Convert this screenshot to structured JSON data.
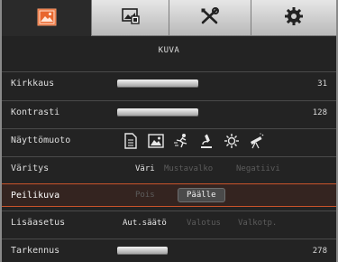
{
  "tabs": [
    {
      "icon": "picture-icon",
      "active": true
    },
    {
      "icon": "display-settings-icon",
      "active": false
    },
    {
      "icon": "tools-icon",
      "active": false
    },
    {
      "icon": "gear-icon",
      "active": false
    }
  ],
  "menu": {
    "title": "KUVA",
    "rows": {
      "brightness": {
        "label": "Kirkkaus",
        "value": "31",
        "level": 31
      },
      "contrast": {
        "label": "Kontrasti",
        "value": "128",
        "level": 128
      },
      "display_mode": {
        "label": "Näyttömuoto",
        "modes": [
          "document-icon",
          "picture-mode-icon",
          "sport-icon",
          "microscope-icon",
          "sun-icon",
          "telescope-icon"
        ]
      },
      "coloring": {
        "label": "Väritys",
        "options": [
          "Väri",
          "Mustavalko",
          "Negatiivi"
        ],
        "selected": "Väri"
      },
      "mirror": {
        "label": "Peilikuva",
        "options": [
          "Pois",
          "Päälle"
        ],
        "selected": "Päälle"
      },
      "extra": {
        "label": "Lisäasetus",
        "options": [
          "Aut.säätö",
          "Valotus",
          "Valkotp."
        ],
        "selected": "Aut.säätö"
      },
      "sharpness": {
        "label": "Tarkennus",
        "value": "278",
        "level": 278
      }
    }
  },
  "colors": {
    "accent": "#e8672e",
    "selected_border": "#c8532a"
  }
}
